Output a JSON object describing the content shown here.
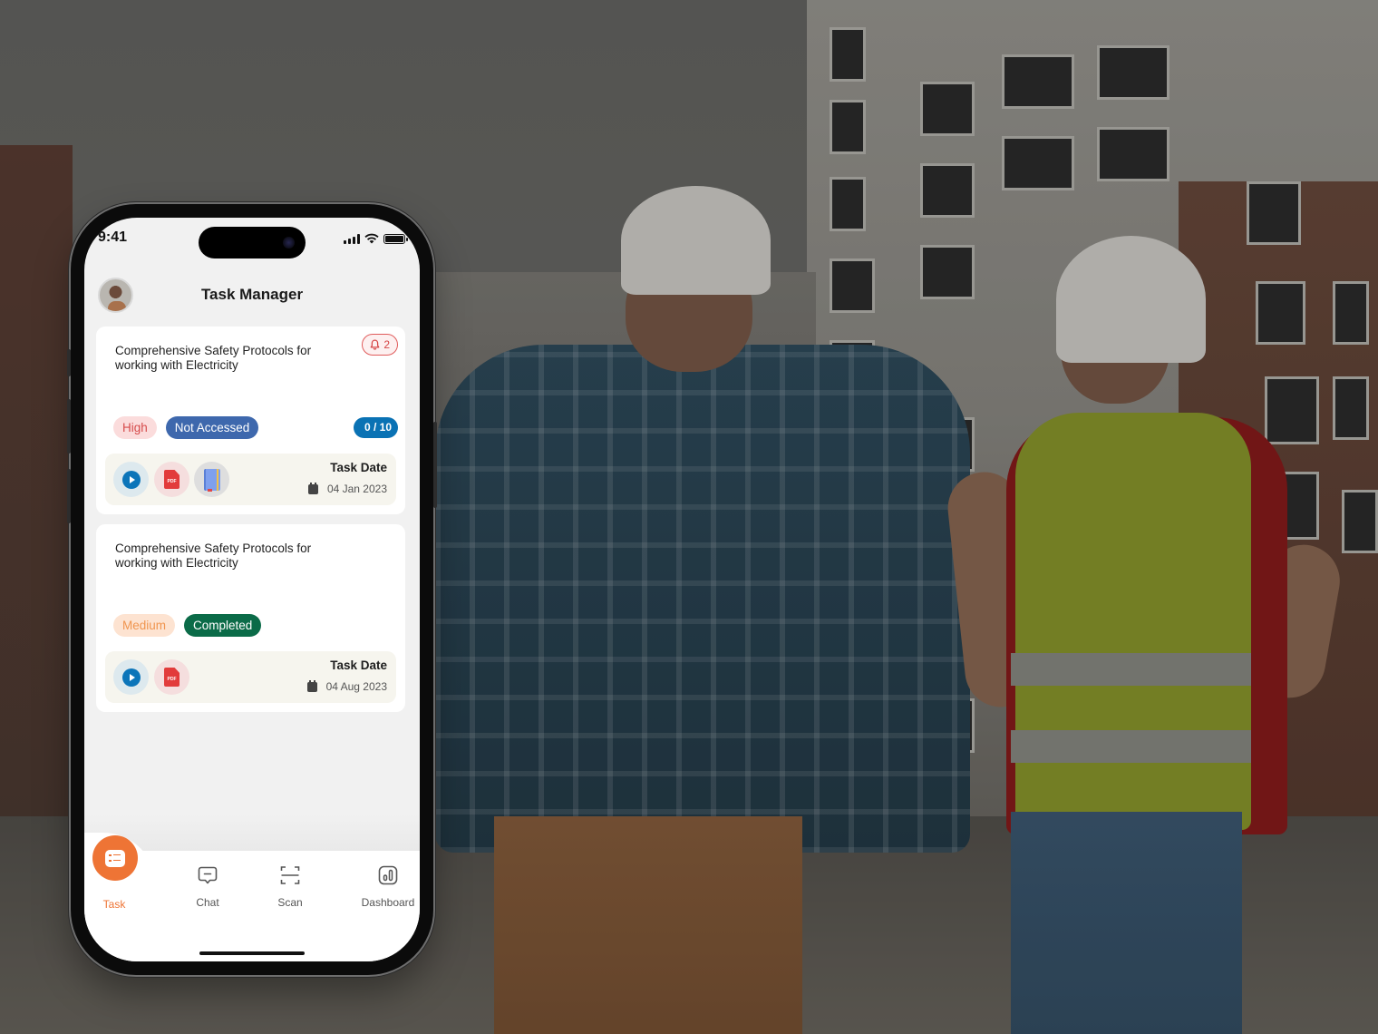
{
  "status_bar": {
    "time": "9:41"
  },
  "header": {
    "title": "Task Manager",
    "avatar_alt": "User avatar"
  },
  "tasks": [
    {
      "title": "Comprehensive Safety Protocols for working with Electricity",
      "alert_count": "2",
      "priority": "High",
      "status": "Not Accessed",
      "progress": "0 / 10",
      "attachments": [
        "video",
        "pdf",
        "book"
      ],
      "date_label": "Task Date",
      "date": "04 Jan 2023"
    },
    {
      "title": "Comprehensive Safety Protocols for working with Electricity",
      "priority": "Medium",
      "status": "Completed",
      "attachments": [
        "video",
        "pdf"
      ],
      "date_label": "Task Date",
      "date": "04 Aug 2023"
    }
  ],
  "bottom_nav": {
    "active": "Task",
    "items": [
      {
        "label": "Task",
        "icon": "checklist-icon"
      },
      {
        "label": "Chat",
        "icon": "chat-bubble-icon"
      },
      {
        "label": "Scan",
        "icon": "scan-frame-icon"
      },
      {
        "label": "Dashboard",
        "icon": "bar-chart-icon"
      }
    ]
  },
  "attachment_labels": {
    "pdf": "PDF"
  },
  "colors": {
    "accent": "#ee7435",
    "priority_high": "#d64c4c",
    "priority_medium": "#f0954f",
    "status_not_accessed": "#3e68ad",
    "status_completed": "#0b6b48",
    "progress_badge": "#0a72b4",
    "alert": "#d64545"
  }
}
